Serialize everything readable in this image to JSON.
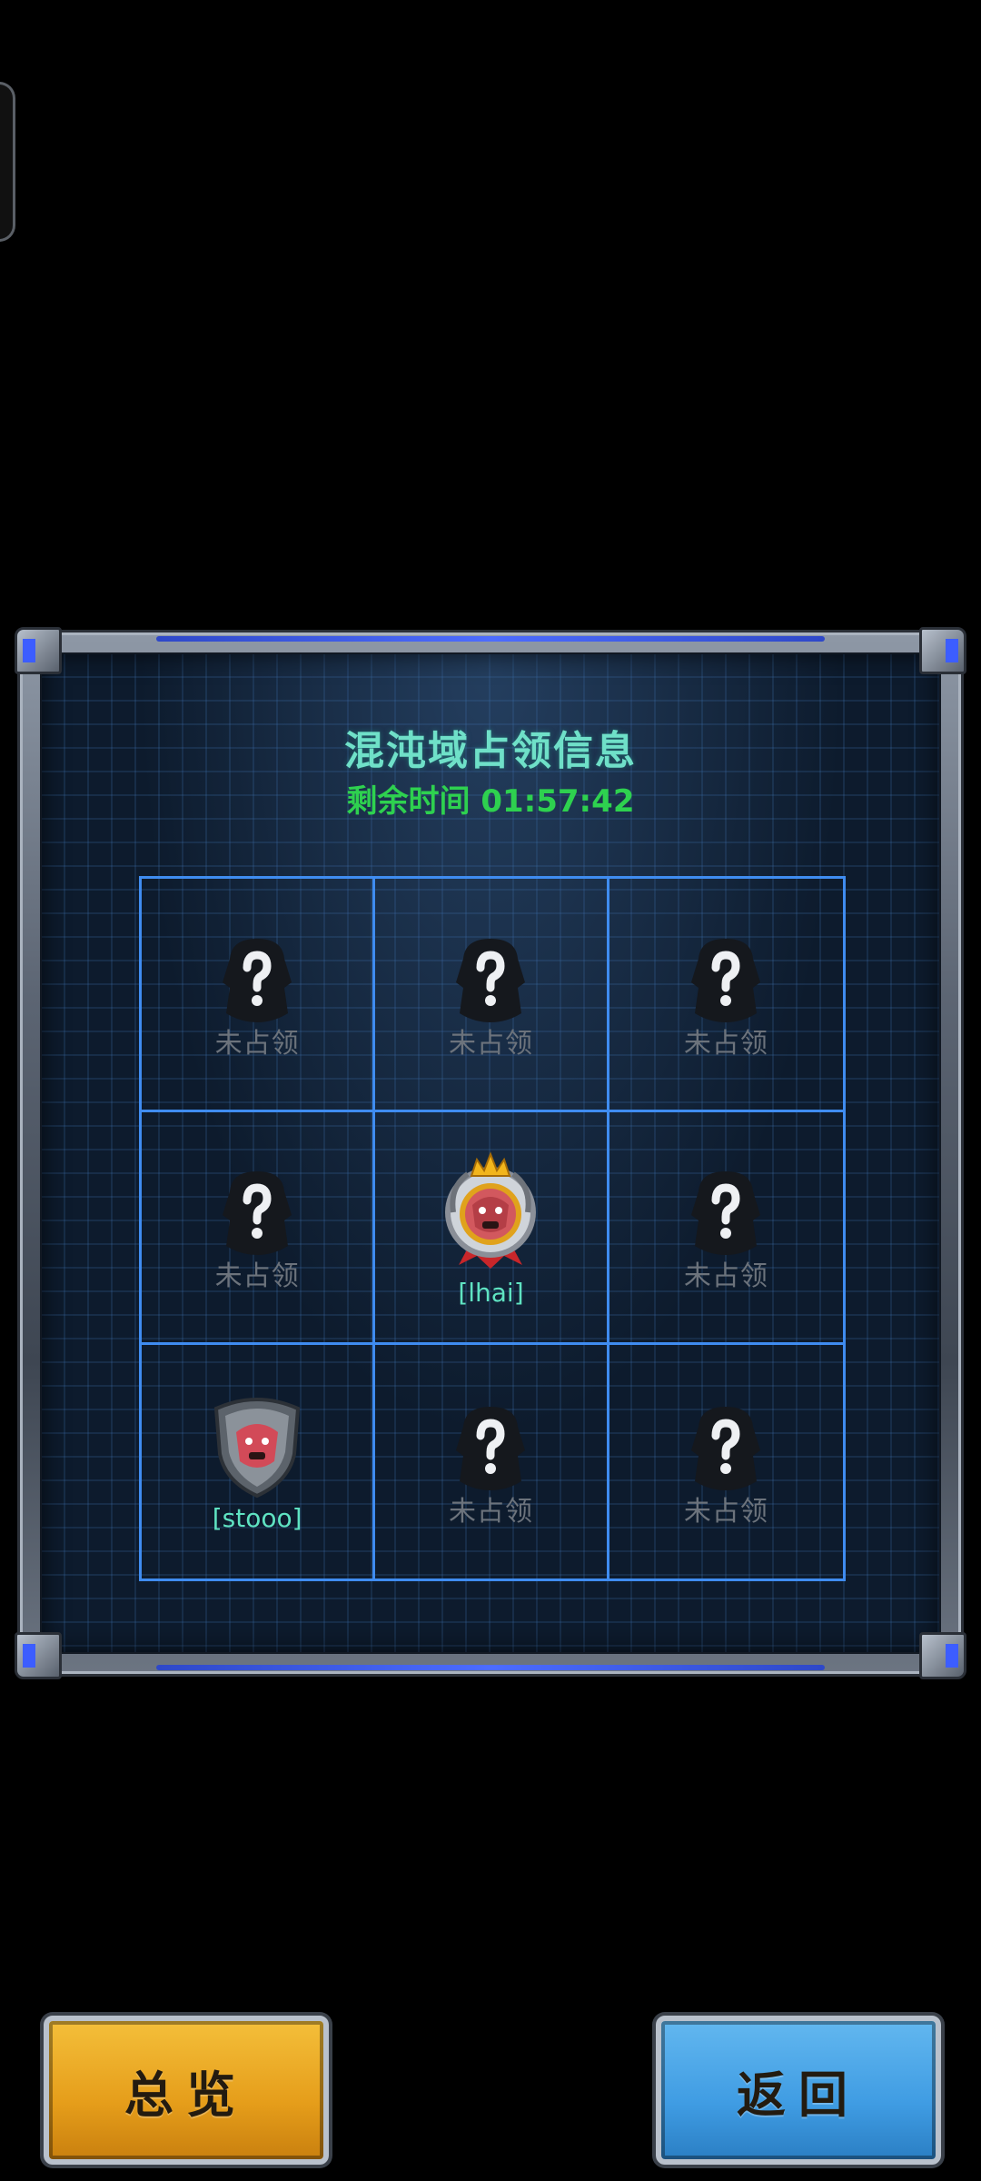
{
  "panel": {
    "title": "混沌域占领信息",
    "timer_label": "剩余时间 01:57:42"
  },
  "grid": {
    "cells": [
      {
        "status": "未占领",
        "owner": ""
      },
      {
        "status": "未占领",
        "owner": ""
      },
      {
        "status": "未占领",
        "owner": ""
      },
      {
        "status": "未占领",
        "owner": ""
      },
      {
        "status": "",
        "owner": "[lhai]",
        "emblem": "crowned-boar-crest-icon"
      },
      {
        "status": "未占领",
        "owner": ""
      },
      {
        "status": "",
        "owner": "[stooo]",
        "emblem": "boar-shield-icon"
      },
      {
        "status": "未占领",
        "owner": ""
      },
      {
        "status": "未占领",
        "owner": ""
      }
    ]
  },
  "buttons": {
    "overview_label": "总览",
    "back_label": "返回"
  },
  "colors": {
    "grid_line": "#3f8cf0",
    "title": "#6fe0c8",
    "timer": "#2ed14f",
    "owner_label": "#5fe3c2",
    "overview_button": "#e59d1a",
    "back_button": "#3f9ce3"
  }
}
